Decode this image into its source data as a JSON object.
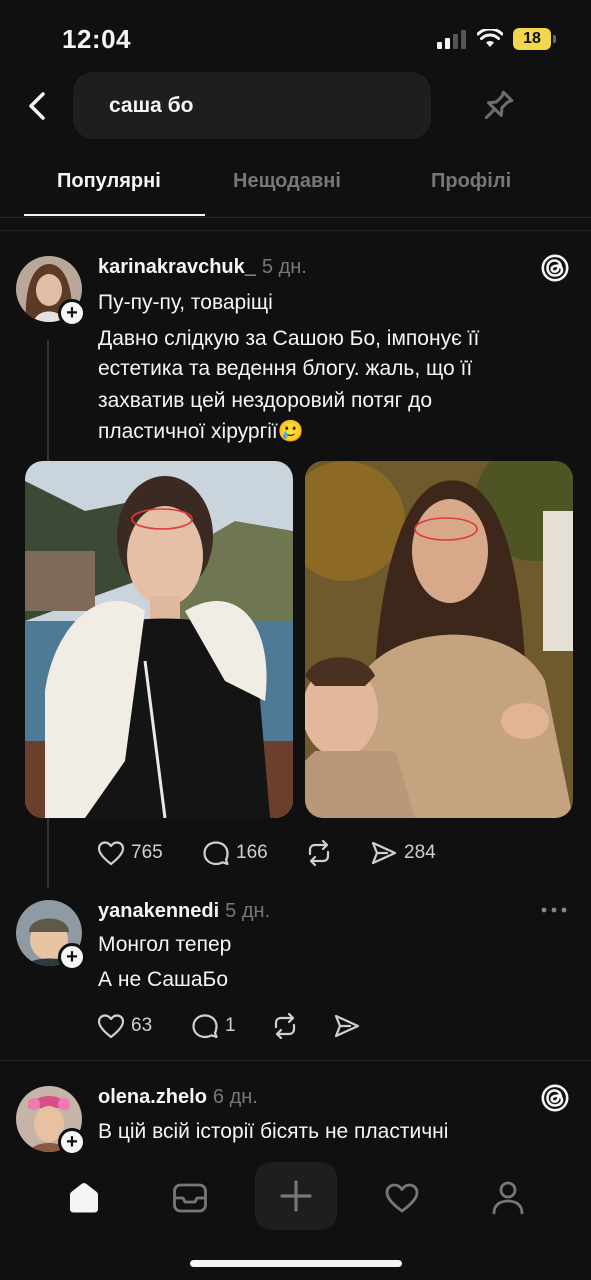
{
  "status_bar": {
    "time": "12:04",
    "battery": "18"
  },
  "search": {
    "query": "саша бо"
  },
  "tabs": [
    {
      "label": "Популярні",
      "active": true
    },
    {
      "label": "Нещодавні",
      "active": false
    },
    {
      "label": "Профілі",
      "active": false
    }
  ],
  "posts": [
    {
      "username": "karinakravchuk_",
      "time": "5 дн.",
      "lines": [
        "Пу-пу-пу, товаріщі",
        "Давно слідкую за Сашою Бо, імпонує її",
        "естетика та ведення блогу. жаль, що її",
        "захватив цей нездоровий потяг до",
        "пластичної хірургії🥲"
      ],
      "likes": "765",
      "comments": "166",
      "shares": "284"
    },
    {
      "username": "yanakennedi",
      "time": "5 дн.",
      "lines": [
        "Монгол тепер",
        "А не СашаБо"
      ],
      "likes": "63",
      "comments": "1"
    },
    {
      "username": "olena.zhelo",
      "time": "6 дн.",
      "lines": [
        "В цій всій історії бісять не пластичні"
      ]
    }
  ],
  "colors": {
    "background": "#101010",
    "text": "#f3f5f7",
    "muted": "#777777",
    "battery": "#f2d64b"
  },
  "icons": [
    "back-icon",
    "pin-icon",
    "threads-icon",
    "more-icon",
    "heart-icon",
    "comment-icon",
    "repost-icon",
    "send-icon",
    "home-icon",
    "inbox-icon",
    "plus-icon",
    "profile-icon"
  ]
}
